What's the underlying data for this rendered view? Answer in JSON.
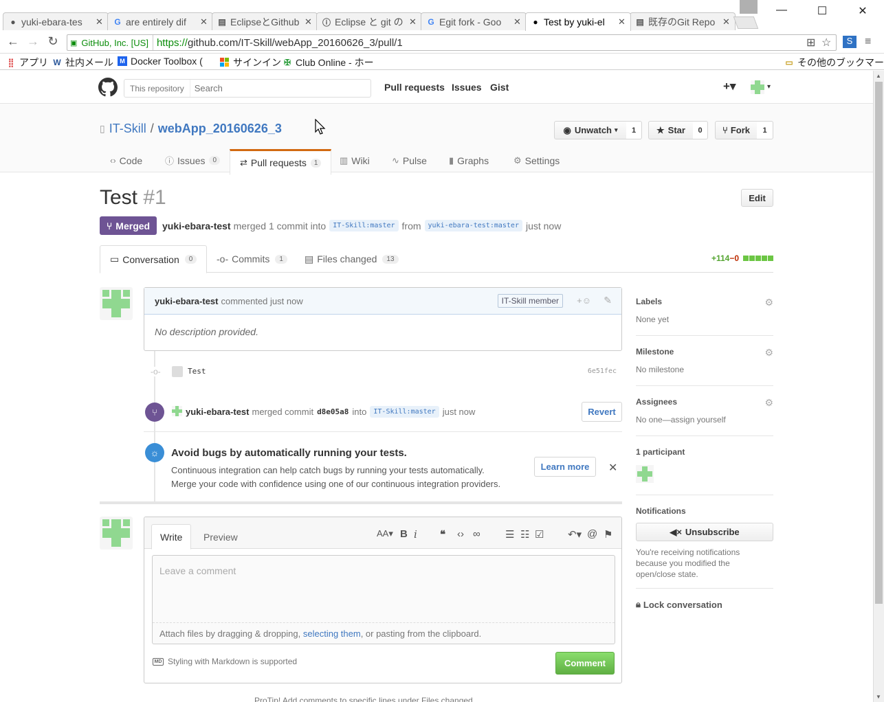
{
  "browser": {
    "tabs": [
      {
        "title": "yuki-ebara-tes",
        "icon": "github-icon"
      },
      {
        "title": "are entirely dif",
        "icon": "google-icon"
      },
      {
        "title": "EclipseとGithub",
        "icon": "page-icon"
      },
      {
        "title": "Eclipse と git の",
        "icon": "info-icon"
      },
      {
        "title": "Egit fork - Goo",
        "icon": "google-icon"
      },
      {
        "title": "Test by yuki-el",
        "icon": "github-icon"
      },
      {
        "title": "既存のGit Repo",
        "icon": "page-icon"
      }
    ],
    "ev_cert": "GitHub, Inc. [US]",
    "url_proto": "https://",
    "url_rest": "github.com/IT-Skill/webApp_20160626_3/pull/1",
    "bookmarks": {
      "apps": "アプリ",
      "mail": "社内メール",
      "docker": "Docker Toolbox (",
      "signin": "サインイン",
      "club": "Club Online - ホー",
      "other": "その他のブックマーク"
    }
  },
  "header": {
    "search_scope": "This repository",
    "search_placeholder": "Search",
    "nav": [
      "Pull requests",
      "Issues",
      "Gist"
    ],
    "plus": "+▾"
  },
  "repo": {
    "owner": "IT-Skill",
    "separator": "/",
    "name": "webApp_20160626_3",
    "unwatch": "Unwatch",
    "unwatch_count": "1",
    "star": "Star",
    "star_count": "0",
    "fork": "Fork",
    "fork_count": "1",
    "tabs": {
      "code": "Code",
      "issues": "Issues",
      "issues_count": "0",
      "pulls": "Pull requests",
      "pulls_count": "1",
      "wiki": "Wiki",
      "pulse": "Pulse",
      "graphs": "Graphs",
      "settings": "Settings"
    }
  },
  "pr": {
    "title": "Test",
    "number": "#1",
    "edit": "Edit",
    "state": "Merged",
    "author": "yuki-ebara-test",
    "meta_text": "merged 1 commit into",
    "base": "IT-Skill:master",
    "from": "from",
    "head": "yuki-ebara-test:master",
    "when": "just now",
    "tabs": {
      "conversation": "Conversation",
      "conversation_count": "0",
      "commits": "Commits",
      "commits_count": "1",
      "files": "Files changed",
      "files_count": "13"
    },
    "additions": "+114",
    "deletions": "−0"
  },
  "comment": {
    "author": "yuki-ebara-test",
    "action": "commented just now",
    "badge": "IT-Skill member",
    "reaction": "+☺",
    "body": "No description provided."
  },
  "commit": {
    "message": "Test",
    "sha": "6e51fec"
  },
  "merge_event": {
    "author": "yuki-ebara-test",
    "text": "merged commit",
    "sha": "d8e05a8",
    "into": "into",
    "branch": "IT-Skill:master",
    "when": "just now",
    "revert": "Revert"
  },
  "ci": {
    "title": "Avoid bugs by automatically running your tests.",
    "line1": "Continuous integration can help catch bugs by running your tests automatically.",
    "line2": "Merge your code with confidence using one of our continuous integration providers.",
    "learn": "Learn more"
  },
  "new_comment": {
    "write": "Write",
    "preview": "Preview",
    "placeholder": "Leave a comment",
    "attach_1": "Attach files by dragging & dropping, ",
    "attach_link": "selecting them",
    "attach_2": ", or pasting from the clipboard.",
    "md_hint": "Styling with Markdown is supported",
    "md_icon": "MD",
    "submit": "Comment",
    "footer_partial": "ProTip! Add comments to specific lines under Files changed."
  },
  "sidebar": {
    "labels_h": "Labels",
    "labels_v": "None yet",
    "milestone_h": "Milestone",
    "milestone_v": "No milestone",
    "assignees_h": "Assignees",
    "assignees_v": "No one—assign yourself",
    "participants_h": "1 participant",
    "notifications_h": "Notifications",
    "unsubscribe": "Unsubscribe",
    "notif_text": "You're receiving notifications because you modified the open/close state.",
    "lock": "Lock conversation"
  },
  "colors": {
    "merged": "#6e5494",
    "link": "#4078c0",
    "add": "#55a532",
    "del": "#bd2c00",
    "comment_btn": "#60b044"
  }
}
